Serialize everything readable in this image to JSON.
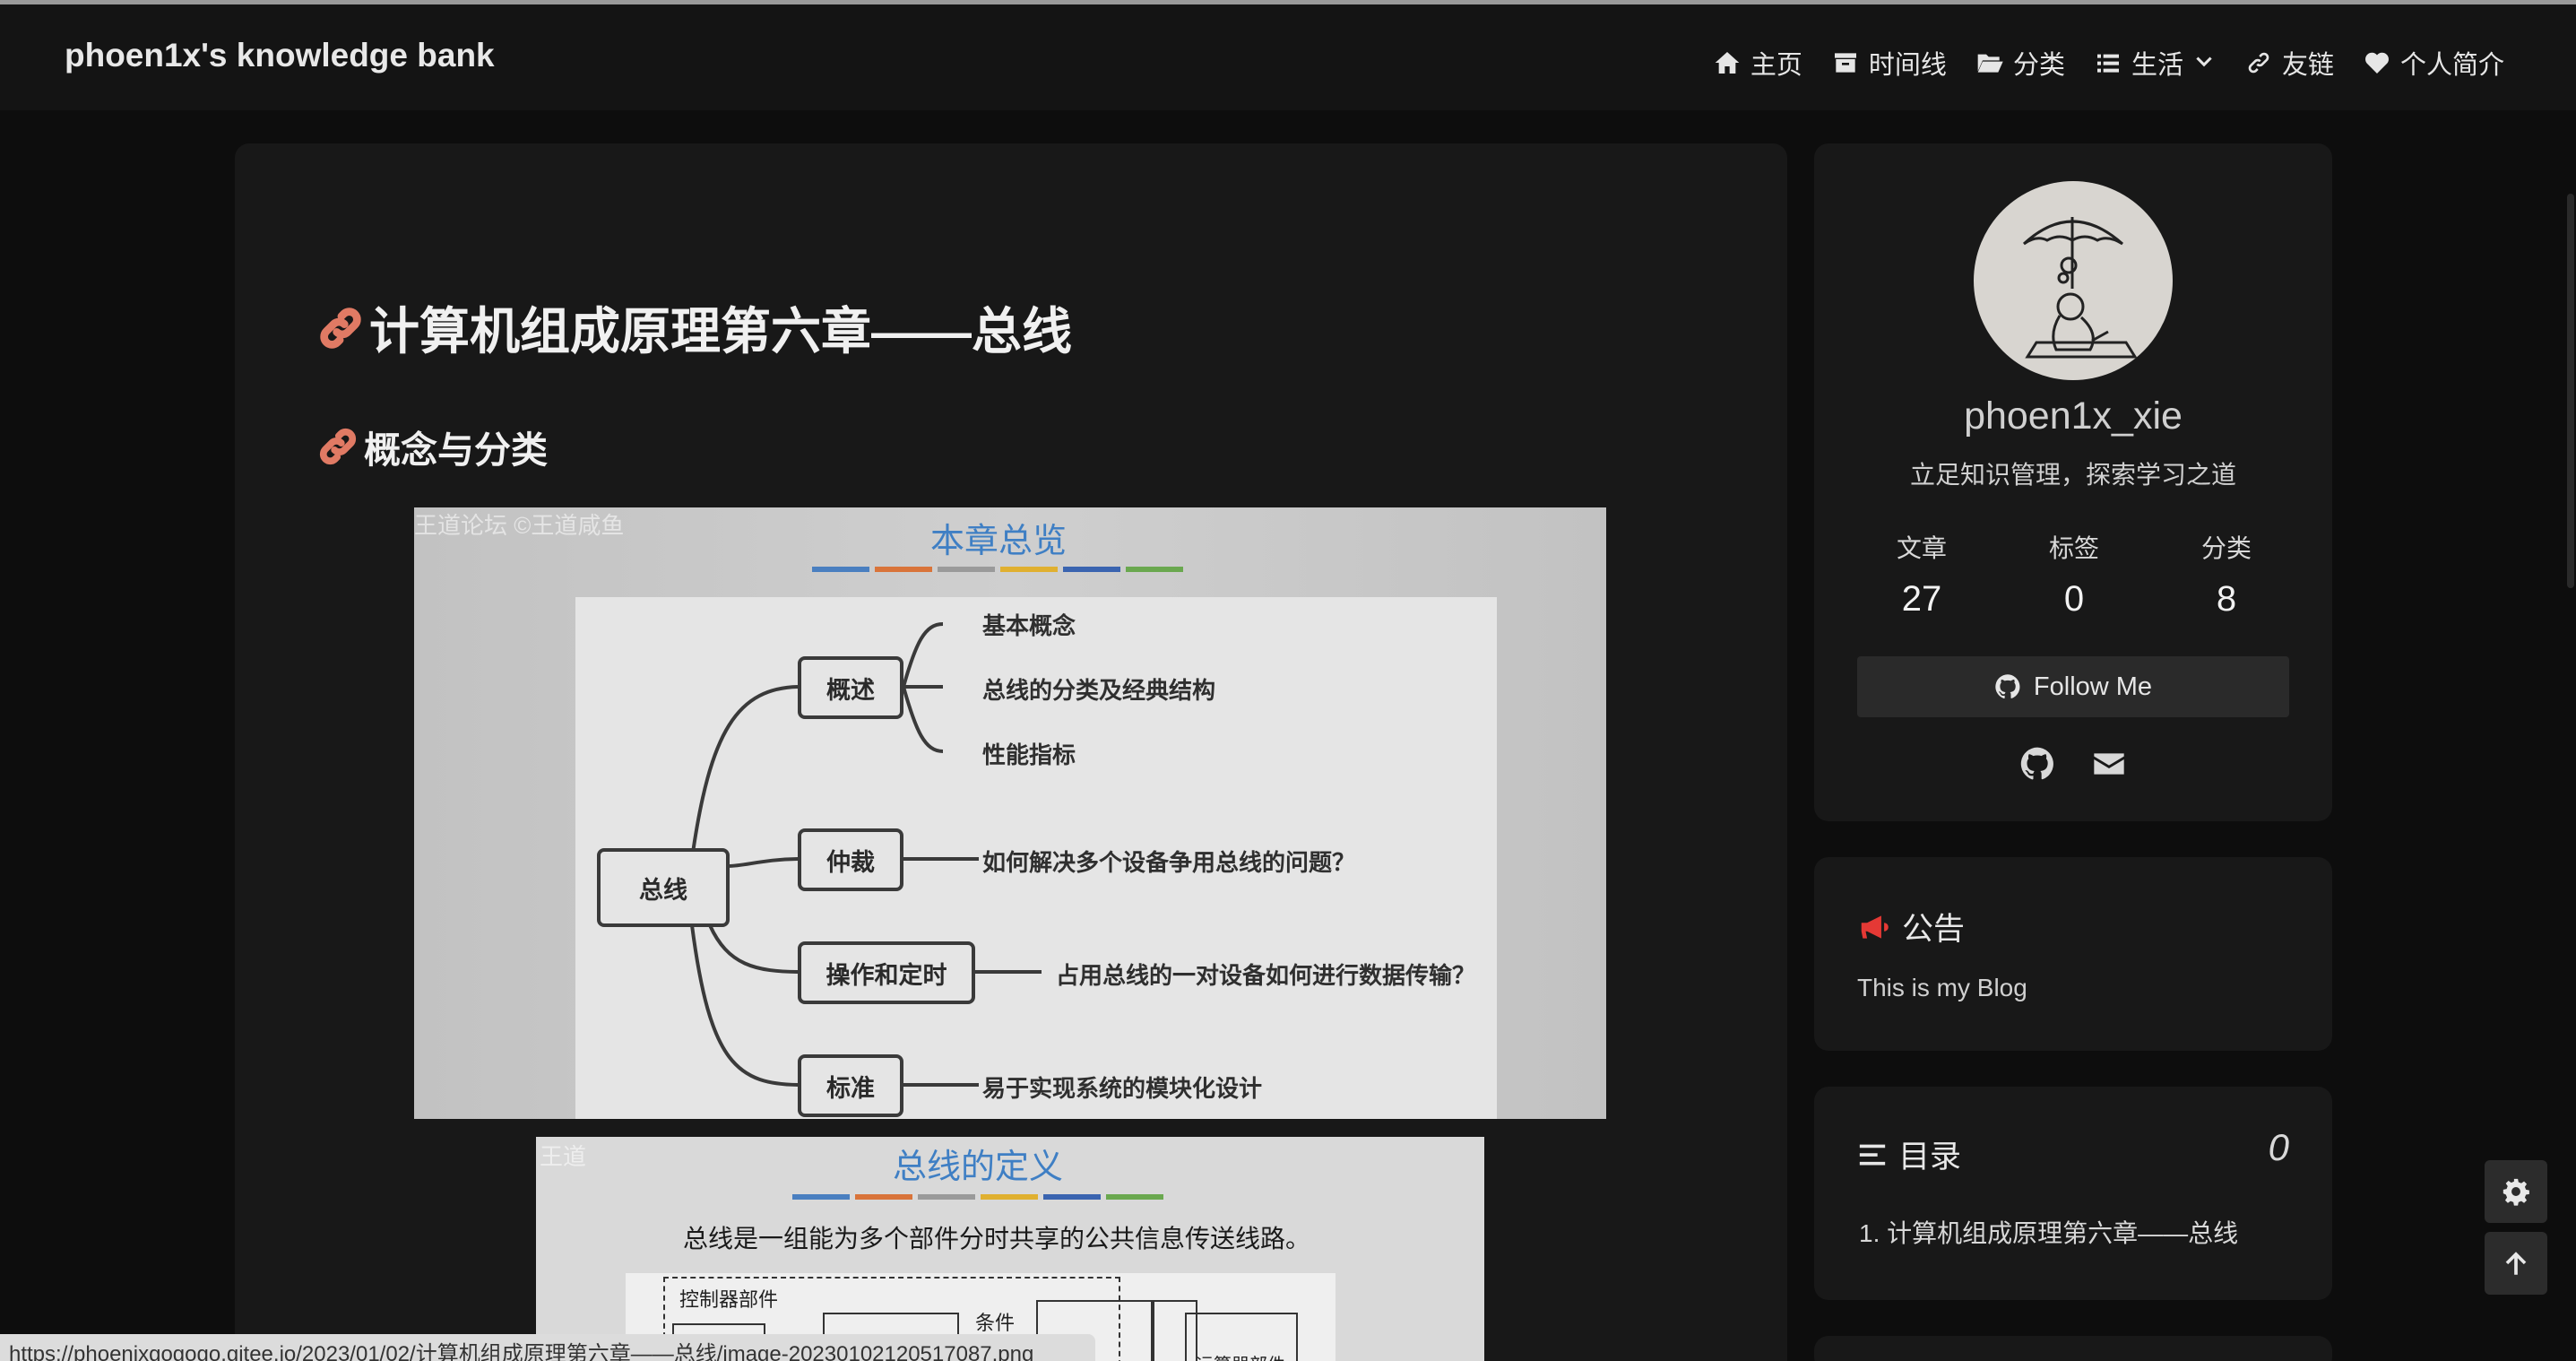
{
  "nav": {
    "brand": "phoen1x's knowledge bank",
    "items": [
      {
        "label": "主页",
        "icon": "home-icon"
      },
      {
        "label": "时间线",
        "icon": "archive-icon"
      },
      {
        "label": "分类",
        "icon": "folder-open-icon"
      },
      {
        "label": "生活",
        "icon": "list-icon"
      },
      {
        "label": "友链",
        "icon": "link-icon"
      },
      {
        "label": "个人简介",
        "icon": "heart-icon"
      }
    ]
  },
  "post": {
    "title": "计算机组成原理第六章——总线",
    "section_title": "概念与分类"
  },
  "figure1": {
    "title": "本章总览",
    "watermark": "王道论坛 ©王道咸鱼",
    "root": "总线",
    "nodes": {
      "overview": "概述",
      "arbitration": "仲裁",
      "timing": "操作和定时",
      "standard": "标准"
    },
    "leaves": {
      "basic_concept": "基本概念",
      "classification": "总线的分类及经典结构",
      "performance": "性能指标",
      "arbitration_q": "如何解决多个设备争用总线的问题？",
      "timing_q": "占用总线的一对设备如何进行数据传输？",
      "standard_desc": "易于实现系统的模块化设计"
    },
    "bar_colors": [
      "#4a7fc0",
      "#d9743a",
      "#9a9a9a",
      "#e0b030",
      "#3a64b0",
      "#6aa84f"
    ]
  },
  "figure2": {
    "title": "总线的定义",
    "watermark": "王道",
    "definition": "总线是一组能为多个部件分时共享的公共信息传送线路。",
    "controller_label": "控制器部件",
    "condition_label": "条件",
    "alu_label": "运算器部件"
  },
  "status_url": "https://phoenixgogogo.gitee.io/2023/01/02/计算机组成原理第六章——总线/image-20230102120517087.png",
  "profile": {
    "name": "phoen1x_xie",
    "description": "立足知识管理，探索学习之道",
    "stats": [
      {
        "label": "文章",
        "value": "27"
      },
      {
        "label": "标签",
        "value": "0"
      },
      {
        "label": "分类",
        "value": "8"
      }
    ],
    "follow_label": "Follow Me"
  },
  "notice": {
    "title": "公告",
    "text": "This is my Blog",
    "icon_color": "#e53935"
  },
  "toc": {
    "title": "目录",
    "count": "0",
    "items": [
      "1. 计算机组成原理第六章——总线"
    ]
  }
}
